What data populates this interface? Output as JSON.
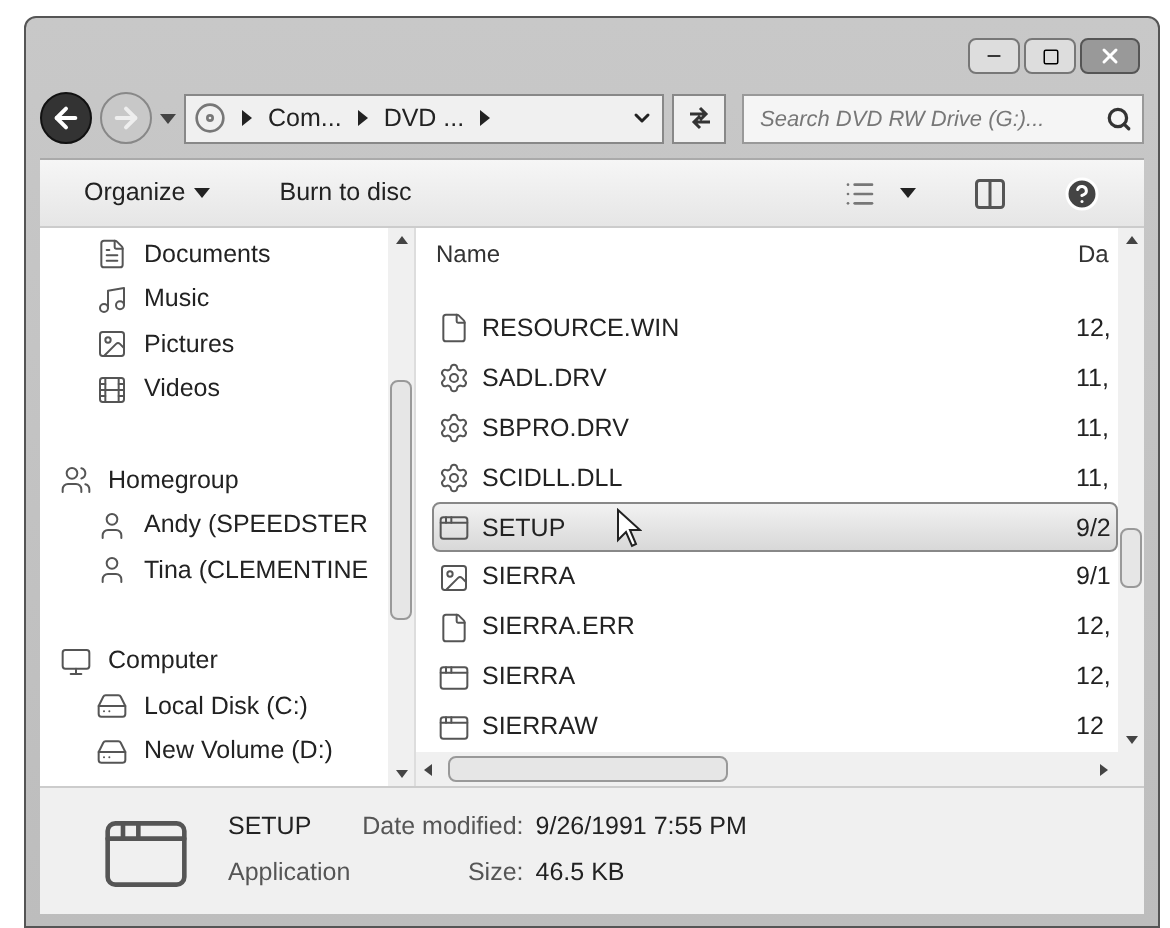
{
  "address_bar": {
    "crumbs": [
      "Com...",
      "DVD ..."
    ]
  },
  "search": {
    "placeholder": "Search DVD RW Drive (G:)..."
  },
  "toolbar": [
    {
      "label": "Organize",
      "dropdown": true
    },
    {
      "label": "Burn to disc",
      "dropdown": false
    }
  ],
  "sidebar": {
    "groups": [
      {
        "children": [
          {
            "label": "Documents",
            "kind": "document"
          },
          {
            "label": "Music",
            "kind": "music"
          },
          {
            "label": "Pictures",
            "kind": "pictures"
          },
          {
            "label": "Videos",
            "kind": "videos"
          }
        ]
      },
      {
        "label": "Homegroup",
        "kind": "homegroup",
        "children": [
          {
            "label": "Andy (SPEEDSTER",
            "kind": "user"
          },
          {
            "label": "Tina (CLEMENTINE",
            "kind": "user"
          }
        ]
      },
      {
        "label": "Computer",
        "kind": "computer",
        "children": [
          {
            "label": "Local Disk (C:)",
            "kind": "disk"
          },
          {
            "label": "New Volume (D:)",
            "kind": "drive"
          }
        ]
      }
    ]
  },
  "file_list": {
    "columns": [
      "Name",
      "Da"
    ],
    "rows": [
      {
        "name": "RESOURCE.WIN",
        "date": "12,",
        "kind": "blank",
        "selected": false
      },
      {
        "name": "SADL.DRV",
        "date": "11,",
        "kind": "driver",
        "selected": false
      },
      {
        "name": "SBPRO.DRV",
        "date": "11,",
        "kind": "driver",
        "selected": false
      },
      {
        "name": "SCIDLL.DLL",
        "date": "11,",
        "kind": "driver",
        "selected": false
      },
      {
        "name": "SETUP",
        "date": "9/2",
        "kind": "setup",
        "selected": true
      },
      {
        "name": "SIERRA",
        "date": "9/1",
        "kind": "image",
        "selected": false
      },
      {
        "name": "SIERRA.ERR",
        "date": "12,",
        "kind": "blank",
        "selected": false
      },
      {
        "name": "SIERRA",
        "date": "12,",
        "kind": "app",
        "selected": false
      },
      {
        "name": "SIERRAW",
        "date": "12",
        "kind": "app",
        "selected": false
      }
    ]
  },
  "details": {
    "name": "SETUP",
    "type": "Application",
    "date_label": "Date modified:",
    "date": "9/26/1991 7:55 PM",
    "size_label": "Size:",
    "size": "46.5 KB"
  }
}
